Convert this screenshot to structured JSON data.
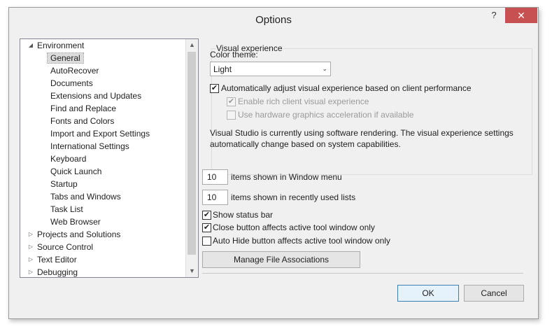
{
  "window": {
    "title": "Options",
    "help_glyph": "?",
    "close_glyph": "✕"
  },
  "tree": {
    "items": [
      {
        "label": "Environment",
        "expander": "◢"
      },
      {
        "label": "General"
      },
      {
        "label": "AutoRecover"
      },
      {
        "label": "Documents"
      },
      {
        "label": "Extensions and Updates"
      },
      {
        "label": "Find and Replace"
      },
      {
        "label": "Fonts and Colors"
      },
      {
        "label": "Import and Export Settings"
      },
      {
        "label": "International Settings"
      },
      {
        "label": "Keyboard"
      },
      {
        "label": "Quick Launch"
      },
      {
        "label": "Startup"
      },
      {
        "label": "Tabs and Windows"
      },
      {
        "label": "Task List"
      },
      {
        "label": "Web Browser"
      },
      {
        "label": "Projects and Solutions",
        "expander": "▷"
      },
      {
        "label": "Source Control",
        "expander": "▷"
      },
      {
        "label": "Text Editor",
        "expander": "▷"
      },
      {
        "label": "Debugging",
        "expander": "▷"
      }
    ],
    "scroll_up": "▲",
    "scroll_down": "▼"
  },
  "visual": {
    "legend": "Visual experience",
    "color_theme_label": "Color theme:",
    "color_theme_value": "Light",
    "dropdown_glyph": "⌄",
    "auto_adjust_label": "Automatically adjust visual experience based on client performance",
    "rich_client_label": "Enable rich client visual experience",
    "hw_accel_label": "Use hardware graphics acceleration if available",
    "info_line1": "Visual Studio is currently using software rendering.  The visual experience settings",
    "info_line2": "automatically change based on system capabilities.",
    "check_glyph": "✔"
  },
  "window_menu": {
    "value": "10",
    "label": "items shown in Window menu"
  },
  "recent_lists": {
    "value": "10",
    "label": "items shown in recently used lists"
  },
  "options": {
    "status_bar_label": "Show status bar",
    "close_button_label": "Close button affects active tool window only",
    "auto_hide_label": "Auto Hide button affects active tool window only"
  },
  "manage_file_assoc_label": "Manage File Associations",
  "ok_label": "OK",
  "cancel_label": "Cancel"
}
